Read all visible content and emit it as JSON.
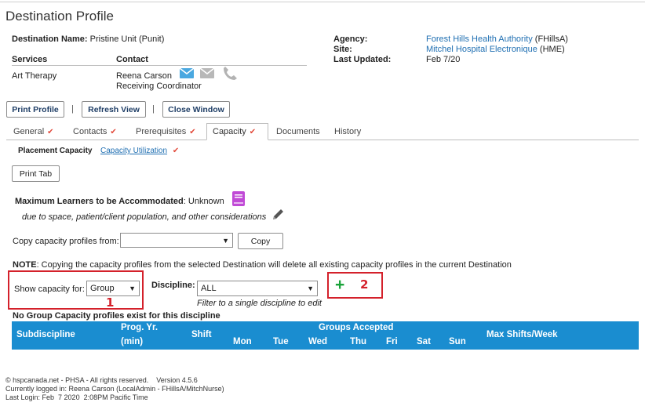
{
  "title": "Destination Profile",
  "destination": {
    "label": "Destination Name:",
    "value": "Pristine Unit (Punit)"
  },
  "agency": {
    "agency_label": "Agency:",
    "agency_value": "Forest Hills Health Authority",
    "agency_code": "(FHillsA)",
    "site_label": "Site:",
    "site_value": "Mitchel Hospital Electronique",
    "site_code": "(HME)",
    "updated_label": "Last Updated:",
    "updated_value": "Feb 7/20"
  },
  "services": {
    "header": "Services",
    "value": "Art Therapy"
  },
  "contact": {
    "header": "Contact",
    "name": "Reena Carson",
    "role": "Receiving Coordinator"
  },
  "toolbar": {
    "print_profile": "Print Profile",
    "refresh_view": "Refresh View",
    "close_window": "Close Window",
    "separator": "|"
  },
  "tabs": [
    {
      "label": "General",
      "check": "✔"
    },
    {
      "label": "Contacts",
      "check": "✔"
    },
    {
      "label": "Prerequisites",
      "check": "✔"
    },
    {
      "label": "Capacity",
      "check": "✔"
    },
    {
      "label": "Documents",
      "check": ""
    },
    {
      "label": "History",
      "check": ""
    }
  ],
  "subtabs": {
    "placement": "Placement Capacity",
    "utilization": "Capacity Utilization",
    "utilization_check": "✔"
  },
  "print_tab": "Print Tab",
  "max_learners": {
    "label": "Maximum Learners to be Accommodated",
    "value": ": Unknown",
    "note": "due to space, patient/client population, and other considerations"
  },
  "copy": {
    "label": "Copy capacity profiles from:",
    "selected": "",
    "button": "Copy"
  },
  "note": {
    "bold": "NOTE",
    "text": ": Copying the capacity profiles from the selected Destination will delete all existing capacity profiles in the current Destination"
  },
  "show_capacity": {
    "label": "Show capacity for:",
    "selected": "Group",
    "marker": "1"
  },
  "discipline": {
    "label": "Discipline:",
    "selected": "ALL",
    "hint": "Filter to a single discipline to edit"
  },
  "add": {
    "plus": "+",
    "marker": "2"
  },
  "empty_message": "No Group Capacity profiles exist for this discipline",
  "table": {
    "subdiscipline": "Subdiscipline",
    "prog_yr": "Prog. Yr.",
    "min": "(min)",
    "shift": "Shift",
    "groups_accepted": "Groups Accepted",
    "days": [
      "Mon",
      "Tue",
      "Wed",
      "Thu",
      "Fri",
      "Sat",
      "Sun"
    ],
    "max_shifts": "Max Shifts/Week"
  },
  "footer": {
    "line1": "© hspcanada.net - PHSA - All rights reserved.    Version 4.5.6",
    "line2": "Currently logged in: Reena Carson (LocalAdmin - FHillsA/MitchNurse)",
    "line3": "Last Login: Feb  7 2020  2:08PM Pacific Time"
  },
  "colors": {
    "link": "#1f6fb2",
    "table_header": "#1a8dd0",
    "check": "#e24a3b",
    "highlight": "#d4212b",
    "plus": "#1aa33a",
    "book_icon": "#c04ad6",
    "envelope_icon": "#4aa8e0"
  }
}
